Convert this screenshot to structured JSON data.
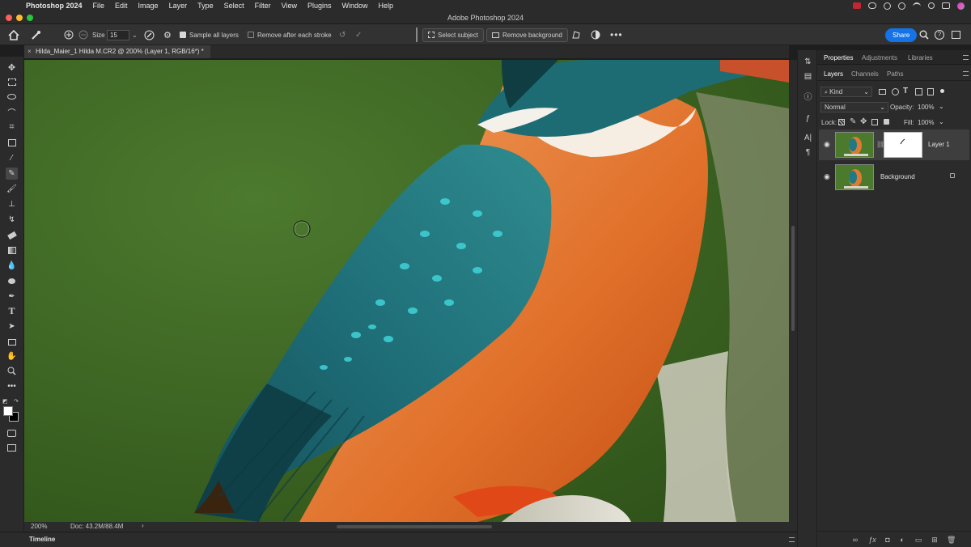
{
  "menubar": {
    "app": "Photoshop 2024",
    "items": [
      "File",
      "Edit",
      "Image",
      "Layer",
      "Type",
      "Select",
      "Filter",
      "View",
      "Plugins",
      "Window",
      "Help"
    ]
  },
  "window": {
    "title": "Adobe Photoshop 2024"
  },
  "options": {
    "size_label": "Size",
    "size_value": "15",
    "sample_all_layers": "Sample all layers",
    "remove_after_stroke": "Remove after each stroke",
    "select_subject": "Select subject",
    "remove_background": "Remove background",
    "share": "Share"
  },
  "document": {
    "tab_title": "Hilda_Maier_1 Hilda M.CR2 @ 200% (Layer 1, RGB/16*) *"
  },
  "status": {
    "zoom": "200%",
    "doc": "Doc: 43.2M/88.4M"
  },
  "timeline": {
    "label": "Timeline"
  },
  "panel": {
    "top_tabs": [
      "Properties",
      "Adjustments",
      "Libraries"
    ],
    "layer_tabs": [
      "Layers",
      "Channels",
      "Paths"
    ],
    "kind_label": "Kind",
    "blend_mode": "Normal",
    "opacity_label": "Opacity:",
    "opacity_value": "100%",
    "lock_label": "Lock:",
    "fill_label": "Fill:",
    "fill_value": "100%",
    "layers": [
      {
        "name": "Layer 1",
        "selected": true
      },
      {
        "name": "Background",
        "selected": false
      }
    ]
  },
  "colors": {
    "accent": "#1473e6",
    "canvas_bg": "#3f6a26"
  }
}
